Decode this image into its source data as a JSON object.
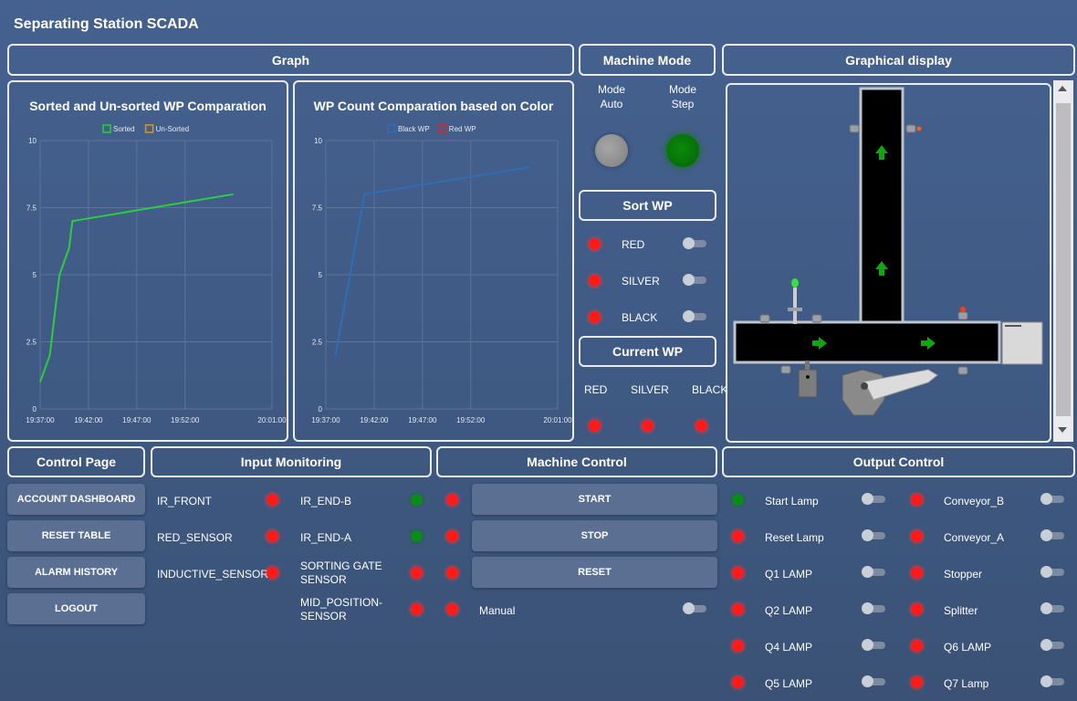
{
  "app_title": "Separating Station SCADA",
  "headers": {
    "graph": "Graph",
    "machine_mode": "Machine Mode",
    "graphical_display": "Graphical display",
    "sort_wp": "Sort WP",
    "current_wp": "Current WP",
    "control_page": "Control Page",
    "input_monitoring": "Input Monitoring",
    "machine_control": "Machine Control",
    "output_control": "Output Control"
  },
  "machine_mode": {
    "auto_line1": "Mode",
    "auto_line2": "Auto",
    "step_line1": "Mode",
    "step_line2": "Step"
  },
  "sort_wp": {
    "items": [
      "RED",
      "SILVER",
      "BLACK"
    ]
  },
  "current_wp": {
    "labels": [
      "RED",
      "SILVER",
      "BLACK"
    ]
  },
  "control_page": {
    "buttons": [
      "ACCOUNT DASHBOARD",
      "RESET TABLE",
      "ALARM HISTORY",
      "LOGOUT"
    ]
  },
  "input_monitoring": {
    "left": [
      "IR_FRONT",
      "RED_SENSOR",
      "INDUCTIVE_SENSOR"
    ],
    "right": [
      "IR_END-B",
      "IR_END-A",
      "SORTING GATE",
      "SENSOR",
      "MID_POSITION-",
      "SENSOR"
    ]
  },
  "machine_control": {
    "buttons": [
      "START",
      "STOP",
      "RESET"
    ],
    "manual_label": "Manual"
  },
  "output_control": {
    "left": [
      "Start Lamp",
      "Reset Lamp",
      "Q1 LAMP",
      "Q2 LAMP",
      "Q4 LAMP",
      "Q5 LAMP"
    ],
    "right": [
      "Conveyor_B",
      "Conveyor_A",
      "Stopper",
      "Splitter",
      "Q6 LAMP",
      "Q7 Lamp"
    ]
  },
  "colors": {
    "led_red": "#ff1a1a",
    "led_green": "#0a8c1a",
    "sorted_line": "#2ecc40",
    "black_wp_line": "#2f6db5"
  },
  "chart_data": [
    {
      "type": "line",
      "title": "Sorted and Un-sorted WP Comparation",
      "legend": [
        "Sorted",
        "Un-Sorted"
      ],
      "legend_colors": [
        "#2ecc40",
        "#d39a2a"
      ],
      "x_ticks": [
        "19:37:00",
        "19:42:00",
        "19:47:00",
        "19:52:00",
        "20:01:00"
      ],
      "y_ticks": [
        "0",
        "2.5",
        "5",
        "7.5",
        "10"
      ],
      "ylim": [
        0,
        10
      ],
      "series": [
        {
          "name": "Sorted",
          "points": [
            [
              "19:37:00",
              1
            ],
            [
              "19:38:00",
              2
            ],
            [
              "19:38:20",
              3
            ],
            [
              "19:39:00",
              5
            ],
            [
              "19:40:00",
              6
            ],
            [
              "19:40:20",
              7
            ],
            [
              "19:57:00",
              8
            ]
          ]
        },
        {
          "name": "Un-Sorted",
          "points": []
        }
      ]
    },
    {
      "type": "line",
      "title": "WP Count Comparation based on Color",
      "legend": [
        "Black WP",
        "Red WP"
      ],
      "legend_colors": [
        "#2f6db5",
        "#d42828"
      ],
      "x_ticks": [
        "19:37:00",
        "19:42:00",
        "19:47:00",
        "19:52:00",
        "20:01:00"
      ],
      "y_ticks": [
        "0",
        "2.5",
        "5",
        "7.5",
        "10"
      ],
      "ylim": [
        0,
        10
      ],
      "series": [
        {
          "name": "Black WP",
          "points": [
            [
              "19:38:00",
              2
            ],
            [
              "19:41:00",
              8
            ],
            [
              "19:58:00",
              9
            ]
          ]
        },
        {
          "name": "Red WP",
          "points": []
        }
      ]
    }
  ]
}
